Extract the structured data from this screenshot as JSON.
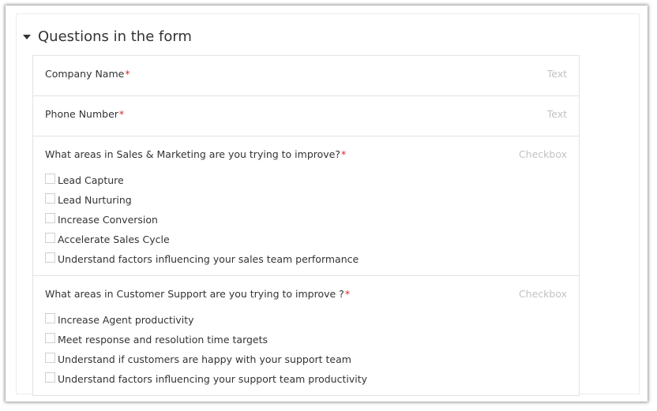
{
  "section": {
    "title": "Questions in the form"
  },
  "questions": [
    {
      "label": "Company Name",
      "required": "*",
      "type": "Text"
    },
    {
      "label": "Phone Number",
      "required": "*",
      "type": "Text"
    },
    {
      "label": "What areas in Sales & Marketing are you trying to improve?",
      "required": "*",
      "type": "Checkbox",
      "options": [
        "Lead Capture",
        "Lead Nurturing",
        "Increase Conversion",
        "Accelerate Sales Cycle",
        "Understand factors influencing your sales team performance"
      ]
    },
    {
      "label": "What areas in Customer Support are you trying to improve ?",
      "required": "*",
      "type": "Checkbox",
      "options": [
        "Increase Agent productivity",
        "Meet response and resolution time targets",
        "Understand if customers are happy with your support team",
        "Understand factors influencing your support team productivity"
      ]
    }
  ]
}
